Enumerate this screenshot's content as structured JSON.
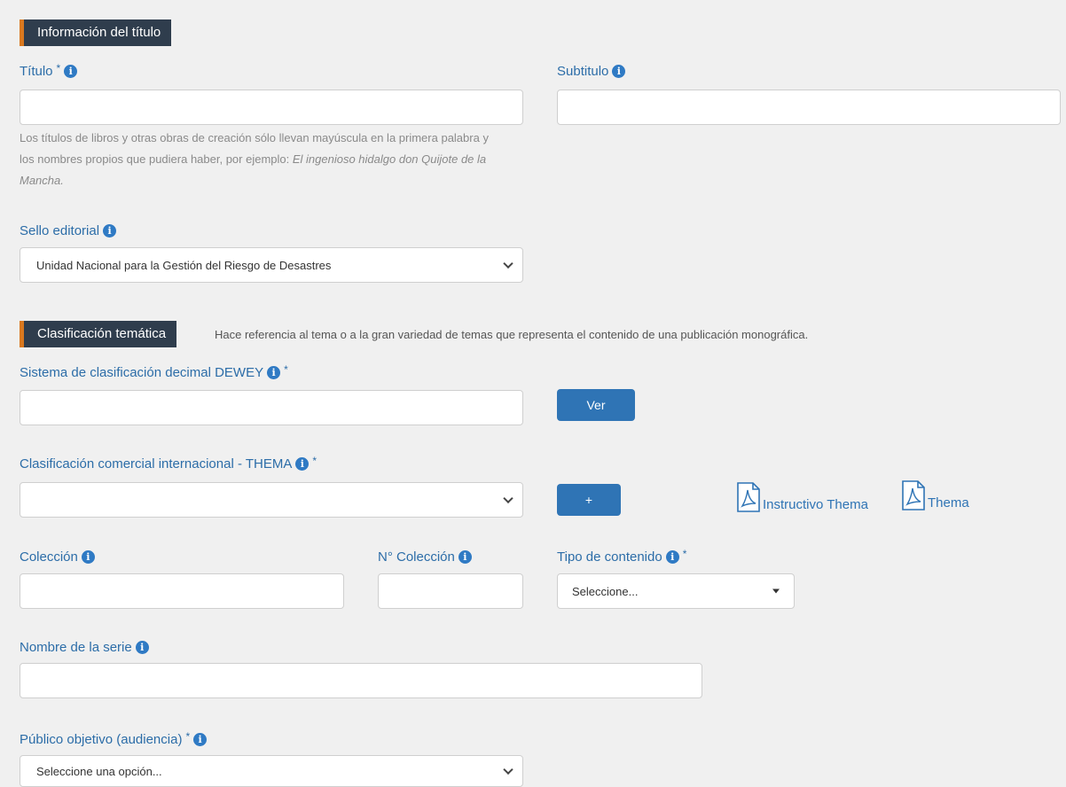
{
  "sections": {
    "titulo_header": "Información del título",
    "clasificacion_header": "Clasificación temática",
    "clasificacion_desc": "Hace referencia al tema o a la gran variedad de temas que representa el contenido de una publicación monográfica."
  },
  "fields": {
    "titulo_label": "Título",
    "subtitulo_label": "Subtitulo",
    "helper_text": "Los títulos de libros y otras obras de creación sólo llevan mayúscula en la primera palabra y los nombres propios que pudiera haber, por ejemplo: ",
    "helper_example": "El ingenioso hidalgo don Quijote de la Mancha.",
    "sello_label": "Sello editorial",
    "sello_value": "Unidad Nacional para la Gestión del Riesgo de Desastres",
    "dewey_label": "Sistema de clasificación decimal DEWEY",
    "ver_button": "Ver",
    "thema_label": "Clasificación comercial internacional - THEMA",
    "add_button": "+",
    "instructivo_link": "Instructivo Thema",
    "thema_link": "Thema",
    "coleccion_label": "Colección",
    "n_coleccion_label": "N° Colección",
    "tipo_label": "Tipo de contenido",
    "tipo_value": "Seleccione...",
    "serie_label": "Nombre de la serie",
    "publico_label": "Público objetivo (audiencia)",
    "publico_value": "Seleccione una opción..."
  },
  "symbols": {
    "required": "*",
    "info": "i"
  },
  "icons": {
    "info": "info-circle-icon",
    "chevron": "chevron-down-icon",
    "caret": "caret-down-icon",
    "pdf": "pdf-file-icon"
  },
  "colors": {
    "header_bg": "#2f3d4d",
    "header_accent": "#d9781f",
    "label": "#2c6da8",
    "button": "#2f74b5"
  }
}
